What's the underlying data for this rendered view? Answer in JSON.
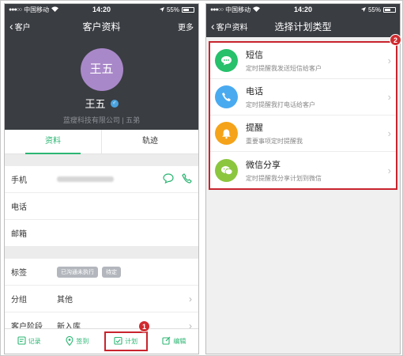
{
  "colors": {
    "accent_green": "#2bb673",
    "nav_dark": "#3a3d42",
    "highlight_red": "#c8242d",
    "avatar_purple": "#a988c9",
    "sms_green": "#27c06b",
    "phone_blue": "#4aaaf0",
    "remind_orange": "#f5a31a",
    "wechat_green": "#8cc63f"
  },
  "status": {
    "carrier": "中国移动",
    "time": "14:20",
    "battery": "55%"
  },
  "left": {
    "nav": {
      "back": "客户",
      "title": "客户资料",
      "more": "更多"
    },
    "profile": {
      "avatar_text": "王五",
      "name": "王五",
      "company": "蓝瘦科技有限公司 | 五弟"
    },
    "tabs": [
      "资料",
      "轨迹"
    ],
    "contact_rows": [
      {
        "label": "手机"
      },
      {
        "label": "电话"
      },
      {
        "label": "邮箱"
      }
    ],
    "info_rows": {
      "tags_label": "标签",
      "tags": [
        "已沟通未执行",
        "待定"
      ],
      "group_label": "分组",
      "group_value": "其他",
      "stage_label": "客户阶段",
      "stage_value": "新入库"
    },
    "toolbar": [
      {
        "label": "记录",
        "icon": "record-icon"
      },
      {
        "label": "签到",
        "icon": "location-pin-icon"
      },
      {
        "label": "计划",
        "icon": "plan-icon"
      },
      {
        "label": "编辑",
        "icon": "edit-icon"
      }
    ],
    "badge": "1"
  },
  "right": {
    "nav": {
      "back": "客户资料",
      "title": "选择计划类型"
    },
    "badge": "2",
    "plans": [
      {
        "title": "短信",
        "desc": "定时提醒我发送短信给客户",
        "icon": "sms-icon"
      },
      {
        "title": "电话",
        "desc": "定时提醒我打电话给客户",
        "icon": "phone-icon"
      },
      {
        "title": "提醒",
        "desc": "重要事项定时提醒我",
        "icon": "bell-icon"
      },
      {
        "title": "微信分享",
        "desc": "定时提醒我分享计划到微信",
        "icon": "wechat-icon"
      }
    ]
  }
}
